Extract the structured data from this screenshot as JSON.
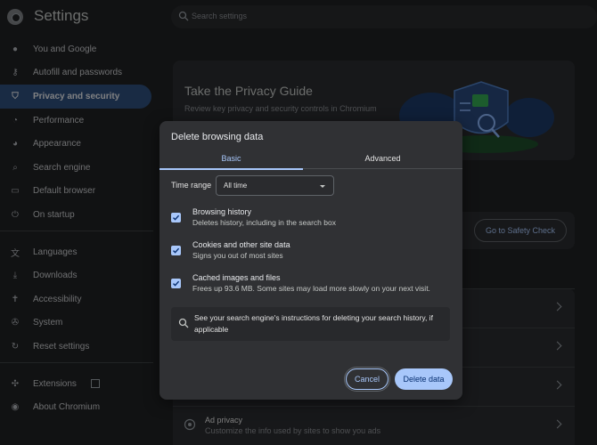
{
  "app": {
    "title": "Settings",
    "search_placeholder": "Search settings"
  },
  "sidebar": {
    "items": [
      {
        "label": "You and Google",
        "icon": "person-icon"
      },
      {
        "label": "Autofill and passwords",
        "icon": "key-icon"
      },
      {
        "label": "Privacy and security",
        "icon": "shield-icon",
        "active": true
      },
      {
        "label": "Performance",
        "icon": "speedometer-icon"
      },
      {
        "label": "Appearance",
        "icon": "palette-icon"
      },
      {
        "label": "Search engine",
        "icon": "search-icon"
      },
      {
        "label": "Default browser",
        "icon": "browser-icon"
      },
      {
        "label": "On startup",
        "icon": "power-icon"
      },
      {
        "label": "Languages",
        "icon": "translate-icon"
      },
      {
        "label": "Downloads",
        "icon": "download-icon"
      },
      {
        "label": "Accessibility",
        "icon": "accessibility-icon"
      },
      {
        "label": "System",
        "icon": "wrench-icon"
      },
      {
        "label": "Reset settings",
        "icon": "reset-icon"
      },
      {
        "label": "Extensions",
        "icon": "puzzle-icon"
      },
      {
        "label": "About Chromium",
        "icon": "chromium-icon"
      }
    ]
  },
  "main": {
    "guide": {
      "title": "Take the Privacy Guide",
      "description": "Review key privacy and security controls in Chromium"
    },
    "safety_check_button": "Go to Safety Check",
    "ad_privacy": {
      "title": "Ad privacy",
      "description": "Customize the info used by sites to show you ads"
    }
  },
  "dialog": {
    "title": "Delete browsing data",
    "tabs": {
      "basic": "Basic",
      "advanced": "Advanced"
    },
    "time_range_label": "Time range",
    "time_range_value": "All time",
    "options": [
      {
        "title": "Browsing history",
        "description": "Deletes history, including in the search box",
        "checked": true
      },
      {
        "title": "Cookies and other site data",
        "description": "Signs you out of most sites",
        "checked": true
      },
      {
        "title": "Cached images and files",
        "description": "Frees up 93.6 MB. Some sites may load more slowly on your next visit.",
        "checked": true
      }
    ],
    "info_text": "See your search engine's instructions for deleting your search history, if applicable",
    "cancel_label": "Cancel",
    "delete_label": "Delete data"
  },
  "colors": {
    "accent": "#a8c7fa",
    "active_nav": "#2f4f7c",
    "background": "#202124",
    "dialog": "#303134"
  }
}
